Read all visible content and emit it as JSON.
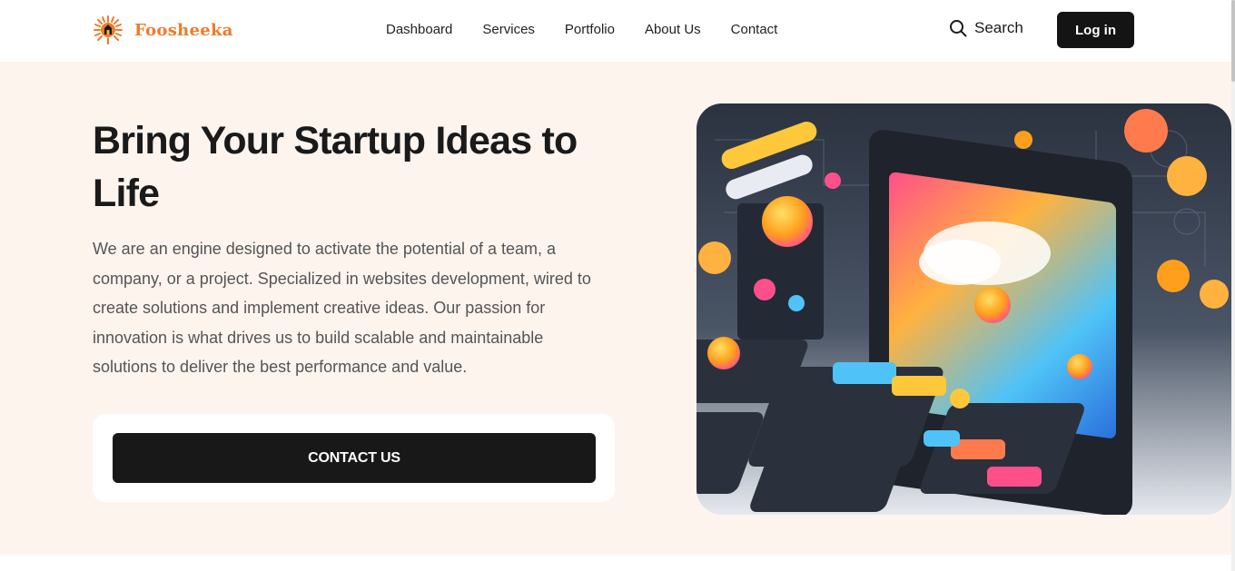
{
  "brand": {
    "name": "Foosheeka",
    "logo_icon": "sunburst-logo-icon",
    "color": "#f07a2a"
  },
  "nav": {
    "items": [
      {
        "label": "Dashboard"
      },
      {
        "label": "Services"
      },
      {
        "label": "Portfolio"
      },
      {
        "label": "About Us"
      },
      {
        "label": "Contact"
      }
    ]
  },
  "header": {
    "search_label": "Search",
    "search_icon": "search-icon",
    "login_label": "Log in"
  },
  "hero": {
    "title": "Bring Your Startup Ideas to Life",
    "description": "We are an engine designed to activate the potential of a team, a company, or a project. Specialized in websites development, wired to create solutions and implement creative ideas. Our passion for innovation is what drives us to build scalable and maintainable solutions to deliver the best performance and value.",
    "cta_label": "CONTACT US",
    "image": "isometric-tech-illustration"
  },
  "colors": {
    "hero_bg": "#fdf4ee",
    "button_bg": "#181818",
    "accent": "#f07a2a"
  }
}
